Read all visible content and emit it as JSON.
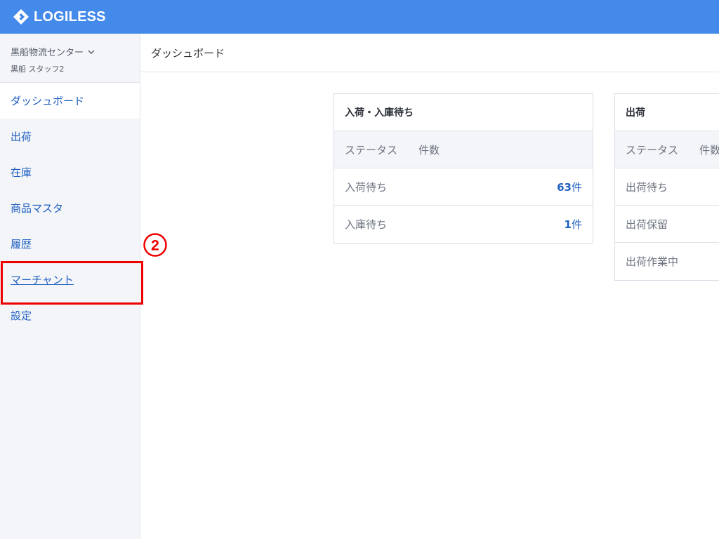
{
  "app": {
    "logo_text": "LOGILESS"
  },
  "sidebar": {
    "org_name": "黒船物流センター",
    "user_name": "黒船 スタッフ2",
    "items": [
      {
        "label": "ダッシュボード"
      },
      {
        "label": "出荷"
      },
      {
        "label": "在庫"
      },
      {
        "label": "商品マスタ"
      },
      {
        "label": "履歴"
      },
      {
        "label": "マーチャント"
      },
      {
        "label": "設定"
      }
    ]
  },
  "annotation": {
    "marker": "②"
  },
  "header": {
    "title": "ダッシュボード"
  },
  "cards": [
    {
      "title": "入荷・入庫待ち",
      "col_status": "ステータス",
      "col_count": "件数",
      "rows": [
        {
          "status": "入荷待ち",
          "count": "63",
          "unit": "件"
        },
        {
          "status": "入庫待ち",
          "count": "1",
          "unit": "件"
        }
      ]
    },
    {
      "title": "出荷",
      "col_status": "ステータス",
      "col_count": "件数",
      "rows": [
        {
          "status": "出荷待ち"
        },
        {
          "status": "出荷保留"
        },
        {
          "status": "出荷作業中"
        }
      ]
    }
  ],
  "colors": {
    "accent": "#448aea",
    "link": "#1f5fbf",
    "highlight": "#e00000"
  }
}
